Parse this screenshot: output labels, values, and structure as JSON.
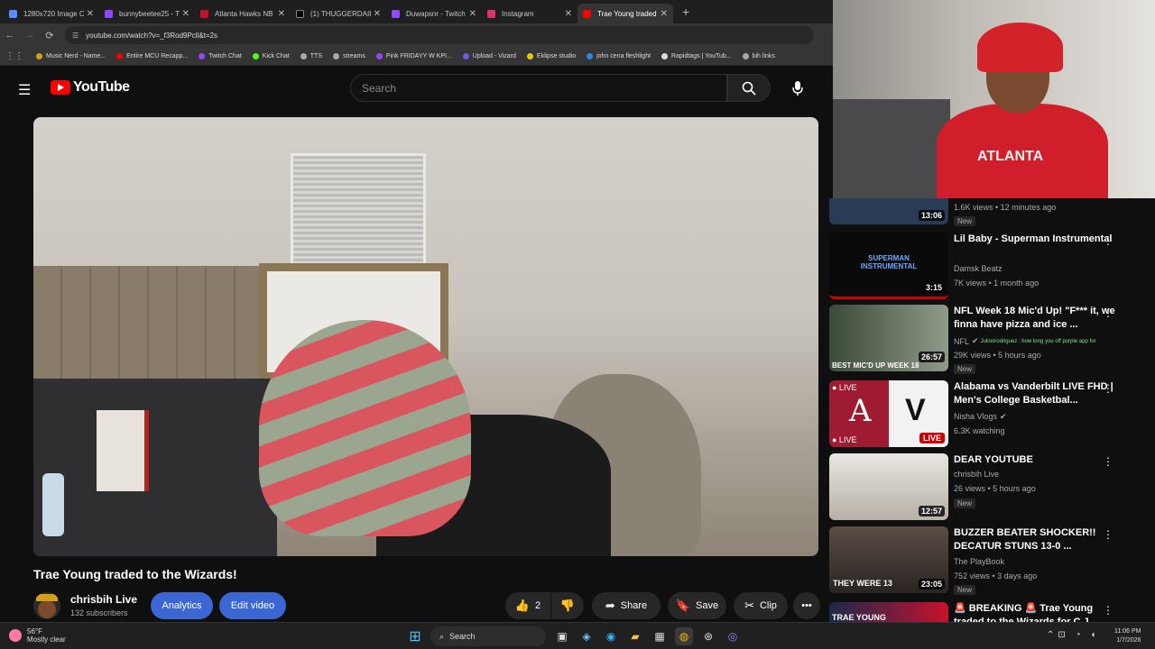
{
  "browser": {
    "tabs": [
      {
        "label": "1280x720 Image C",
        "color": "#5b8cff"
      },
      {
        "label": "bunnybeetee25 - T",
        "color": "#9147ff"
      },
      {
        "label": "Atlanta Hawks NB",
        "color": "#c8102e"
      },
      {
        "label": "(1) THUGGERDAIL",
        "color": "#000000"
      },
      {
        "label": "Duwapsnr - Twitch",
        "color": "#9147ff"
      },
      {
        "label": "Instagram",
        "color": "#e1306c"
      },
      {
        "label": "Trae Young traded",
        "color": "#ff0000"
      }
    ],
    "url": "youtube.com/watch?v=_f3Rod9Pcll&t=2s",
    "bookmarks": [
      {
        "label": "Music Nerd - Name...",
        "color": "#d4a017"
      },
      {
        "label": "Entire MCU Recapp...",
        "color": "#ff0000"
      },
      {
        "label": "Twitch Chat",
        "color": "#9147ff"
      },
      {
        "label": "Kick Chat",
        "color": "#53fc18"
      },
      {
        "label": "TTS",
        "color": "#aaaaaa"
      },
      {
        "label": "streams",
        "color": "#aaaaaa"
      },
      {
        "label": "Pink FRIDAYY W KPI...",
        "color": "#9147ff"
      },
      {
        "label": "Upload - Vizard",
        "color": "#6c5ce7"
      },
      {
        "label": "Eklipse studio",
        "color": "#f1c40f"
      },
      {
        "label": "john cena fleshlight",
        "color": "#2e86de"
      },
      {
        "label": "Rapidtags | YouTub...",
        "color": "#dddddd"
      },
      {
        "label": "bih links",
        "color": "#aaaaaa"
      }
    ]
  },
  "youtube": {
    "logo": "YouTube",
    "search_placeholder": "Search"
  },
  "video": {
    "title": "Trae Young traded to the Wizards!",
    "channel": "chrisbih Live",
    "subscribers": "132 subscribers",
    "analytics_label": "Analytics",
    "edit_label": "Edit video",
    "likes": "2",
    "share_label": "Share",
    "save_label": "Save",
    "clip_label": "Clip"
  },
  "recommendations": [
    {
      "title": "",
      "channel": "",
      "views": "1.6K views • 12 minutes ago",
      "duration": "13:06",
      "badge": "New",
      "live": false
    },
    {
      "title": "Lil Baby - Superman Instrumental",
      "channel": "Damsk Beatz",
      "views": "7K views • 1 month ago",
      "duration": "3:15",
      "badge": "",
      "live": false
    },
    {
      "title": "NFL Week 18 Mic'd Up! \"F*** it, we finna have pizza and ice ...",
      "channel": "NFL",
      "views": "29K views • 5 hours ago",
      "duration": "26:57",
      "badge": "New",
      "live": false
    },
    {
      "title": "Alabama vs Vanderbilt LIVE FHD | Men's College Basketbal...",
      "channel": "Nisha Vlogs",
      "views": "6.3K watching",
      "duration": "LIVE",
      "badge": "",
      "live": true
    },
    {
      "title": "DEAR YOUTUBE",
      "channel": "chrisbih Live",
      "views": "26 views • 5 hours ago",
      "duration": "12:57",
      "badge": "New",
      "live": false
    },
    {
      "title": "BUZZER BEATER SHOCKER!! DECATUR STUNS 13-0 ...",
      "channel": "The PlayBook",
      "views": "752 views • 3 days ago",
      "duration": "23:05",
      "badge": "New",
      "live": false
    },
    {
      "title": "🚨 BREAKING 🚨 Trae Young traded to the Wizards for C.J. ...",
      "channel": "",
      "views": "",
      "duration": "",
      "badge": "",
      "live": false
    }
  ],
  "nfl_comment": "Julioorodriguez : how long you off purple app for",
  "thumb_texts": {
    "superman": "SUPERMAN INSTRUMENTAL",
    "nfl": "BEST MIC'D UP WEEK 18",
    "live_top": "● LIVE",
    "live_bottom": "● LIVE",
    "buzzer": "THEY WERE 13",
    "trae": "TRAE YOUNG"
  },
  "taskbar": {
    "temp": "56°F",
    "condition": "Mostly clear",
    "search_label": "Search",
    "time": "11:06 PM",
    "date": "1/7/2026"
  }
}
